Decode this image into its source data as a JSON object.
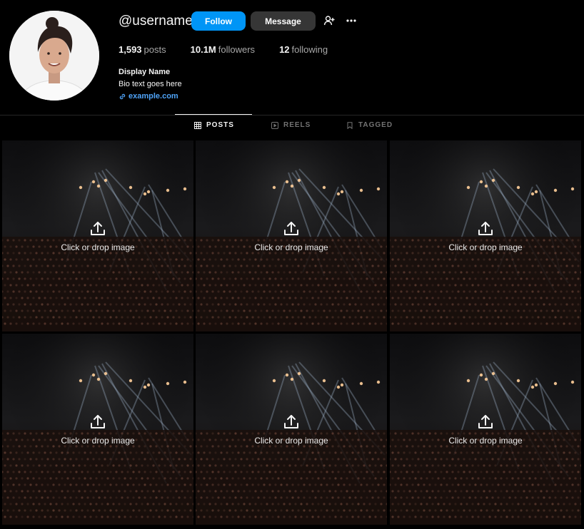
{
  "profile": {
    "username": "@username",
    "display_name": "Display Name",
    "bio": "Bio text goes here",
    "link": "example.com",
    "avatar_icon": "avatar-photo"
  },
  "actions": {
    "follow_label": "Follow",
    "message_label": "Message",
    "follow_color": "#0095f6"
  },
  "stats": {
    "posts_count": "1,593",
    "posts_label": "posts",
    "followers_count": "10.1M",
    "followers_label": "followers",
    "following_count": "12",
    "following_label": "following"
  },
  "tabs": [
    {
      "label": "POSTS",
      "icon": "grid-icon",
      "active": true
    },
    {
      "label": "REELS",
      "icon": "reels-icon",
      "active": false
    },
    {
      "label": "TAGGED",
      "icon": "tag-icon",
      "active": false
    }
  ],
  "grid": {
    "upload_label": "Click or drop image",
    "cells": [
      {
        "label": "Click or drop image"
      },
      {
        "label": "Click or drop image"
      },
      {
        "label": "Click or drop image"
      },
      {
        "label": "Click or drop image"
      },
      {
        "label": "Click or drop image"
      },
      {
        "label": "Click or drop image"
      }
    ]
  }
}
